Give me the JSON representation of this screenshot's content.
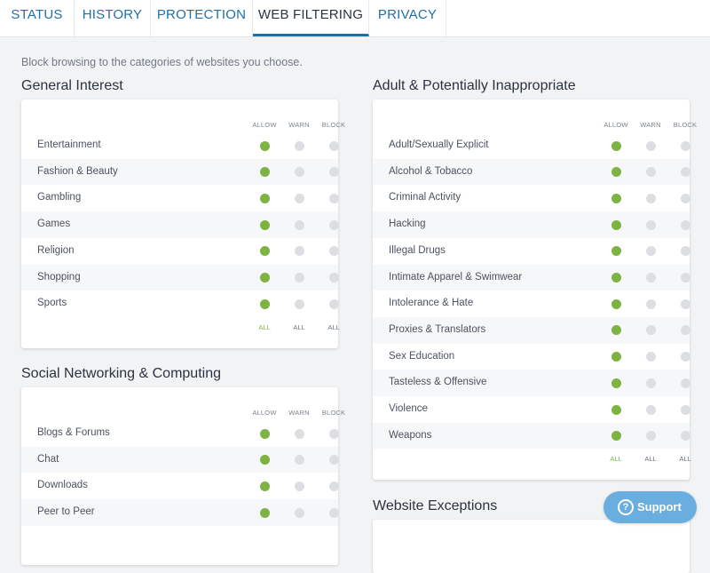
{
  "tabs": [
    {
      "label": "STATUS"
    },
    {
      "label": "HISTORY"
    },
    {
      "label": "PROTECTION"
    },
    {
      "label": "WEB FILTERING"
    },
    {
      "label": "PRIVACY"
    }
  ],
  "active_tab": "WEB FILTERING",
  "intro": "Block browsing to the categories of websites you choose.",
  "column_headers": {
    "allow": "ALLOW",
    "warn": "WARN",
    "block": "BLOCK"
  },
  "all_label": "ALL",
  "colors": {
    "accent": "#1f6fa8",
    "allow_on": "#7cb342",
    "off": "#dcdee1",
    "support": "#6aaee0"
  },
  "general": {
    "title": "General Interest",
    "rows": [
      {
        "label": "Entertainment",
        "state": "allow"
      },
      {
        "label": "Fashion & Beauty",
        "state": "allow"
      },
      {
        "label": "Gambling",
        "state": "allow"
      },
      {
        "label": "Games",
        "state": "allow"
      },
      {
        "label": "Religion",
        "state": "allow"
      },
      {
        "label": "Shopping",
        "state": "allow"
      },
      {
        "label": "Sports",
        "state": "allow"
      }
    ]
  },
  "social": {
    "title": "Social Networking & Computing",
    "rows": [
      {
        "label": "Blogs & Forums",
        "state": "allow"
      },
      {
        "label": "Chat",
        "state": "allow"
      },
      {
        "label": "Downloads",
        "state": "allow"
      },
      {
        "label": "Peer to Peer",
        "state": "allow"
      }
    ]
  },
  "adult": {
    "title": "Adult & Potentially Inappropriate",
    "rows": [
      {
        "label": "Adult/Sexually Explicit",
        "state": "allow"
      },
      {
        "label": "Alcohol & Tobacco",
        "state": "allow"
      },
      {
        "label": "Criminal Activity",
        "state": "allow"
      },
      {
        "label": "Hacking",
        "state": "allow"
      },
      {
        "label": "Illegal Drugs",
        "state": "allow"
      },
      {
        "label": "Intimate Apparel & Swimwear",
        "state": "allow"
      },
      {
        "label": "Intolerance & Hate",
        "state": "allow"
      },
      {
        "label": "Proxies & Translators",
        "state": "allow"
      },
      {
        "label": "Sex Education",
        "state": "allow"
      },
      {
        "label": "Tasteless & Offensive",
        "state": "allow"
      },
      {
        "label": "Violence",
        "state": "allow"
      },
      {
        "label": "Weapons",
        "state": "allow"
      }
    ]
  },
  "exceptions": {
    "title": "Website Exceptions"
  },
  "support": {
    "label": "Support",
    "icon": "question-circle-icon"
  }
}
